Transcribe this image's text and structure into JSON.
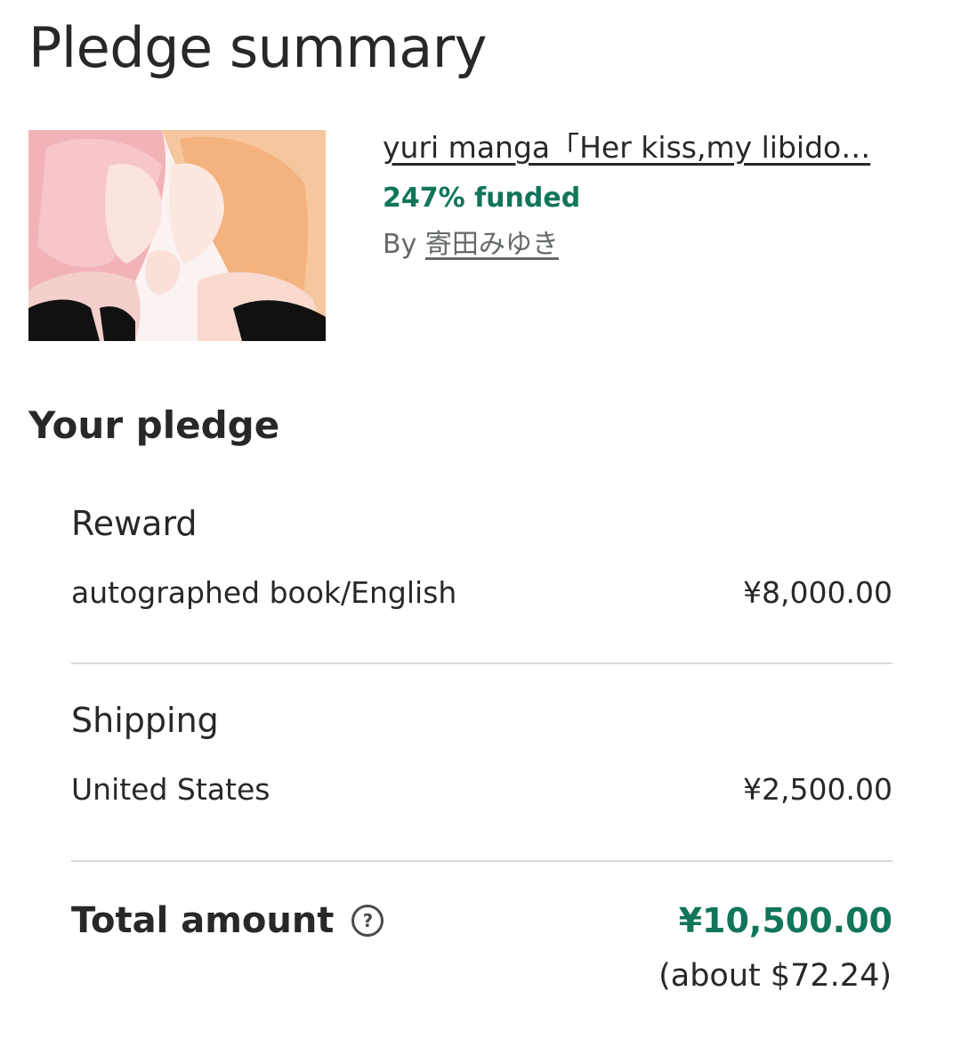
{
  "page": {
    "title": "Pledge summary"
  },
  "project": {
    "image_alt": "Project thumbnail: two manga characters",
    "title": "yuri manga「Her kiss,my libido…",
    "funded": "247% funded",
    "by_label": "By",
    "creator": "寄田みゆき"
  },
  "pledge": {
    "heading": "Your pledge",
    "reward": {
      "label": "Reward",
      "item": "autographed book/English",
      "amount": "¥8,000.00"
    },
    "shipping": {
      "label": "Shipping",
      "destination": "United States",
      "amount": "¥2,500.00"
    },
    "total": {
      "label": "Total amount",
      "help_icon": "question-circle-icon",
      "amount": "¥10,500.00",
      "approx": "(about $72.24)"
    }
  },
  "colors": {
    "accent_green": "#117559",
    "text": "#282828",
    "muted": "#656969",
    "divider": "#d9d9d9"
  }
}
